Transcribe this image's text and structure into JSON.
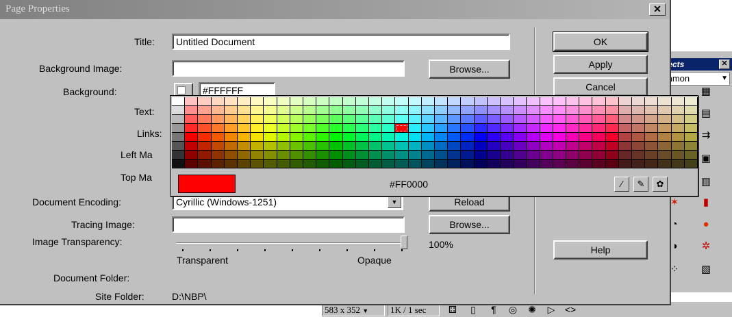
{
  "dialog": {
    "title": "Page Properties",
    "close_glyph": "✕",
    "title_label": "Title:",
    "title_value": "Untitled Document",
    "bg_image_label": "Background Image:",
    "background_label": "Background:",
    "background_value": "#FFFFFF",
    "text_label": "Text:",
    "links_label": "Links:",
    "left_margin_label": "Left Ma",
    "top_margin_label": "Top Ma",
    "encoding_label": "Document Encoding:",
    "encoding_value": "Cyrillic (Windows-1251)",
    "tracing_label": "Tracing Image:",
    "transparency_label": "Image Transparency:",
    "transparency_value": "100%",
    "transparency_level": 1.0,
    "transparent_label": "Transparent",
    "opaque_label": "Opaque",
    "doc_folder_label": "Document Folder:",
    "site_folder_label": "Site Folder:",
    "site_folder_value": "D:\\NBP\\",
    "buttons": {
      "ok": "OK",
      "apply": "Apply",
      "cancel": "Cancel",
      "browse": "Browse...",
      "reload": "Reload",
      "help": "Help"
    }
  },
  "color_picker": {
    "selected_hex": "#FF0000",
    "selected_color": "#ff0000",
    "icons": [
      "eyedropper-icon",
      "eraser-icon",
      "palette-icon"
    ]
  },
  "objects_panel": {
    "title": "jects",
    "dropdown_value": "mmon"
  },
  "status_bar": {
    "window_size": "583 x 352",
    "download": "1K / 1 sec"
  }
}
